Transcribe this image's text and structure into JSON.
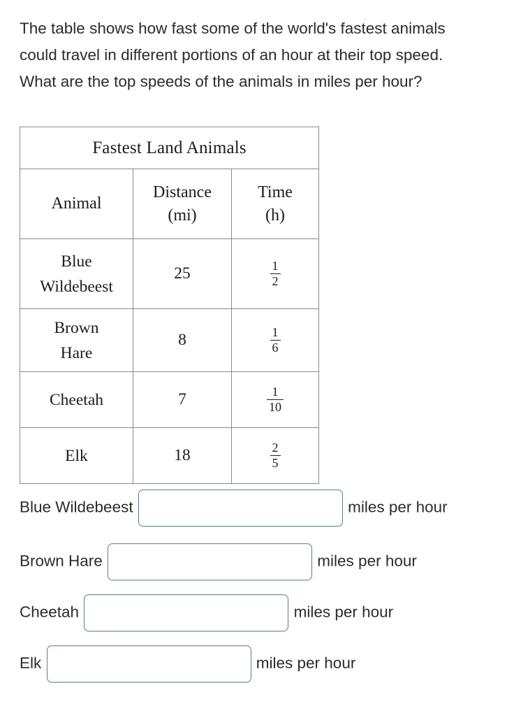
{
  "question": {
    "text": "The table shows how fast some of the world's fastest animals could travel in different portions of an hour at their top speed. What are the top speeds of the animals in miles per hour?"
  },
  "table": {
    "title": "Fastest Land Animals",
    "headers": {
      "animal": "Animal",
      "distance_line1": "Distance",
      "distance_line2": "(mi)",
      "time_line1": "Time",
      "time_line2": "(h)"
    },
    "rows": [
      {
        "animal_line1": "Blue",
        "animal_line2": "Wildebeest",
        "distance": "25",
        "time_numerator": "1",
        "time_denominator": "2"
      },
      {
        "animal_line1": "Brown",
        "animal_line2": "Hare",
        "distance": "8",
        "time_numerator": "1",
        "time_denominator": "6"
      },
      {
        "animal_line1": "Cheetah",
        "animal_line2": "",
        "distance": "7",
        "time_numerator": "1",
        "time_denominator": "10"
      },
      {
        "animal_line1": "Elk",
        "animal_line2": "",
        "distance": "18",
        "time_numerator": "2",
        "time_denominator": "5"
      }
    ]
  },
  "answers": [
    {
      "label": "Blue Wildebeest ",
      "value": "",
      "unit": " miles per hour"
    },
    {
      "label": "Brown Hare ",
      "value": "",
      "unit": " miles per hour"
    },
    {
      "label": "Cheetah ",
      "value": "",
      "unit": " miles per hour"
    },
    {
      "label": "Elk ",
      "value": "",
      "unit": " miles per hour"
    }
  ],
  "colors": {
    "text": "#2b2b2b",
    "table_border": "#8a8a8a",
    "input_border": "#5b7d8e",
    "background": "#ffffff"
  }
}
